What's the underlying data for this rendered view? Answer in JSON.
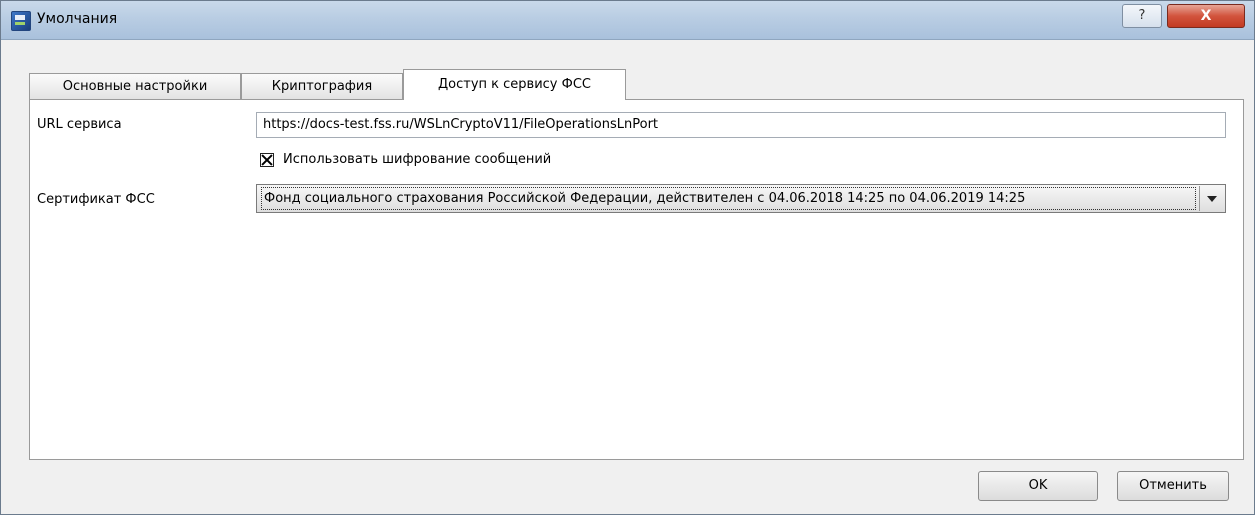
{
  "window": {
    "title": "Умолчания"
  },
  "titlebar": {
    "help_label": "?",
    "close_label": "X"
  },
  "tabs": [
    {
      "label": "Основные настройки"
    },
    {
      "label": "Криптография"
    },
    {
      "label": "Доступ к сервису ФСС"
    }
  ],
  "form": {
    "url_label": "URL сервиса",
    "url_value": "https://docs-test.fss.ru/WSLnCryptoV11/FileOperationsLnPort",
    "encrypt_label": "Использовать шифрование сообщений",
    "encrypt_checked": true,
    "cert_label": "Сертификат ФСС",
    "cert_value": "Фонд социального страхования Российской Федерации, действителен с 04.06.2018 14:25 по 04.06.2019 14:25"
  },
  "buttons": {
    "ok_label": "OK",
    "cancel_label": "Отменить"
  }
}
